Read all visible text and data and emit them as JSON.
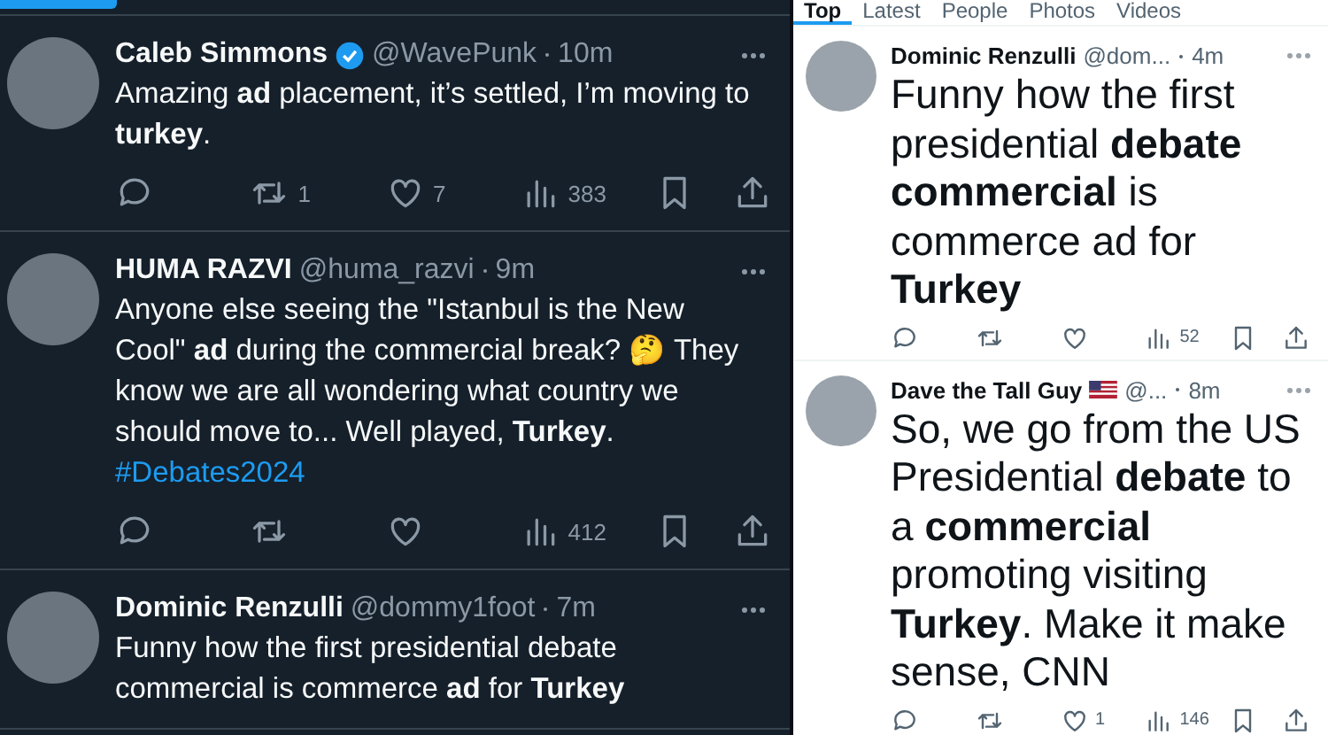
{
  "dark_feed": {
    "tweets": [
      {
        "name": "Caleb Simmons",
        "verified": true,
        "handle": "@WavePunk",
        "time": "10m",
        "text": "Amazing **ad** placement, it’s settled, I’m moving to **turkey**.",
        "actions": {
          "reposts": "1",
          "likes": "7",
          "views": "383"
        }
      },
      {
        "name": "HUMA RAZVI",
        "handle": "@huma_razvi",
        "time": "9m",
        "text": "Anyone else seeing the  \"Istanbul is the New Cool\" **ad** during the commercial break? 🤔 They know we are all wondering what country we should move to... Well played, **Turkey**.",
        "hashtag": "#Debates2024",
        "actions": {
          "views": "412"
        }
      },
      {
        "name": "Dominic Renzulli",
        "handle": "@dommy1foot",
        "time": "7m",
        "text": "Funny how the first presidential debate commercial is commerce **ad** for **Turkey**"
      }
    ]
  },
  "light_feed": {
    "tabs": [
      {
        "label": "Top",
        "selected": true
      },
      {
        "label": "Latest",
        "selected": false
      },
      {
        "label": "People",
        "selected": false
      },
      {
        "label": "Photos",
        "selected": false
      },
      {
        "label": "Videos",
        "selected": false
      }
    ],
    "tweets": [
      {
        "name": "Dominic Renzulli",
        "handle": "@dom...",
        "time": "4m",
        "text": "Funny how the first presidential **debate commercial** is commerce ad for **Turkey**",
        "actions": {
          "views": "52"
        }
      },
      {
        "name": "Dave the Tall Guy",
        "flag": true,
        "handle": "@...",
        "time": "8m",
        "text": "So, we go from the US Presidential **debate** to a **commercial** promoting visiting **Turkey**. Make it make sense, CNN",
        "actions": {
          "likes": "1",
          "views": "146"
        }
      }
    ]
  }
}
